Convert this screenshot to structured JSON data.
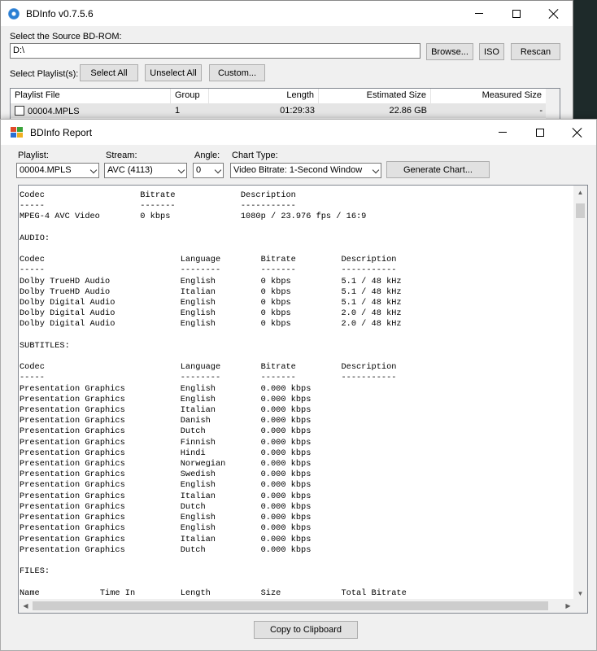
{
  "main_window": {
    "title": "BDInfo v0.7.5.6",
    "source_label": "Select the Source BD-ROM:",
    "source_value": "D:\\",
    "browse_label": "Browse...",
    "iso_label": "ISO",
    "rescan_label": "Rescan",
    "playlists_label": "Select Playlist(s):",
    "select_all_label": "Select All",
    "unselect_all_label": "Unselect All",
    "custom_label": "Custom...",
    "columns": [
      "Playlist File",
      "Group",
      "Length",
      "Estimated Size",
      "Measured Size"
    ],
    "rows": [
      {
        "file": "00004.MPLS",
        "group": "1",
        "length": "01:29:33",
        "est_size": "22.86 GB",
        "measured": "-"
      }
    ]
  },
  "report_window": {
    "title": "BDInfo Report",
    "playlist_label": "Playlist:",
    "playlist_value": "00004.MPLS",
    "stream_label": "Stream:",
    "stream_value": "AVC (4113)",
    "angle_label": "Angle:",
    "angle_value": "0",
    "chart_type_label": "Chart Type:",
    "chart_type_value": "Video Bitrate: 1-Second Window",
    "generate_label": "Generate Chart...",
    "copy_label": "Copy to Clipboard",
    "report_text": "Codec                   Bitrate             Description\n-----                   -------             -----------\nMPEG-4 AVC Video        0 kbps              1080p / 23.976 fps / 16:9\n\nAUDIO:\n\nCodec                           Language        Bitrate         Description\n-----                           --------        -------         -----------\nDolby TrueHD Audio              English         0 kbps          5.1 / 48 kHz\nDolby TrueHD Audio              Italian         0 kbps          5.1 / 48 kHz\nDolby Digital Audio             English         0 kbps          5.1 / 48 kHz\nDolby Digital Audio             English         0 kbps          2.0 / 48 kHz\nDolby Digital Audio             English         0 kbps          2.0 / 48 kHz\n\nSUBTITLES:\n\nCodec                           Language        Bitrate         Description\n-----                           --------        -------         -----------\nPresentation Graphics           English         0.000 kbps\nPresentation Graphics           English         0.000 kbps\nPresentation Graphics           Italian         0.000 kbps\nPresentation Graphics           Danish          0.000 kbps\nPresentation Graphics           Dutch           0.000 kbps\nPresentation Graphics           Finnish         0.000 kbps\nPresentation Graphics           Hindi           0.000 kbps\nPresentation Graphics           Norwegian       0.000 kbps\nPresentation Graphics           Swedish         0.000 kbps\nPresentation Graphics           English         0.000 kbps\nPresentation Graphics           Italian         0.000 kbps\nPresentation Graphics           Dutch           0.000 kbps\nPresentation Graphics           English         0.000 kbps\nPresentation Graphics           English         0.000 kbps\nPresentation Graphics           Italian         0.000 kbps\nPresentation Graphics           Dutch           0.000 kbps\n\nFILES:\n\nName            Time In         Length          Size            Total Bitrate"
  }
}
